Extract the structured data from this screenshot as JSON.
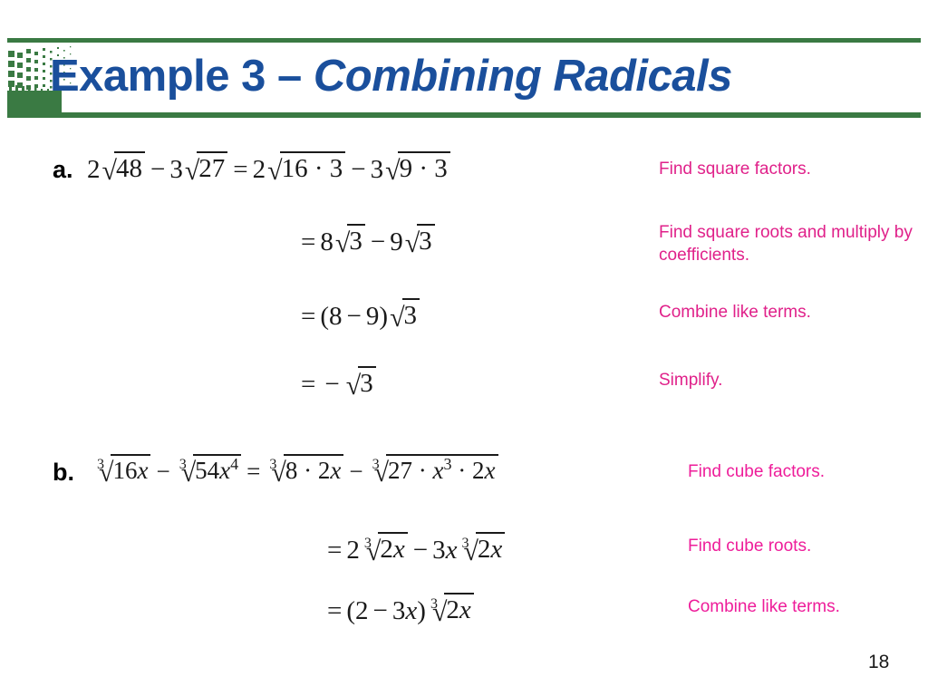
{
  "slide": {
    "title_prefix": "Example 3 – ",
    "title_emphasis": "Combining Radicals",
    "page_number": "18",
    "colors": {
      "rule_green": "#3a7a43",
      "title_blue": "#1a4f9c",
      "note_magenta": "#e0218a",
      "note_magenta_bright": "#ee1d9a",
      "math_black": "#1a1a1a"
    },
    "logo": {
      "name": "halftone-fan-logo",
      "color": "#3a7a43"
    }
  },
  "parts": [
    {
      "label": "a.",
      "lines": [
        {
          "expr_text": "2√48 − 3√27 = 2√(16 · 3) − 3√(9 · 3)",
          "note": "Find square factors."
        },
        {
          "expr_text": "= 8√3 − 9√3",
          "note": "Find square roots and multiply by coefficients."
        },
        {
          "expr_text": "= (8 − 9)√3",
          "note": "Combine like terms."
        },
        {
          "expr_text": "= −√3",
          "note": "Simplify."
        }
      ]
    },
    {
      "label": "b.",
      "lines": [
        {
          "expr_text": "∛(16x) − ∛(54x⁴) = ∛(8 · 2x) − ∛(27 · x³ · 2x)",
          "note": "Find cube factors."
        },
        {
          "expr_text": "= 2∛(2x) − 3x∛(2x)",
          "note": "Find cube roots."
        },
        {
          "expr_text": "= (2 − 3x)∛(2x)",
          "note": "Combine like terms."
        }
      ]
    }
  ]
}
